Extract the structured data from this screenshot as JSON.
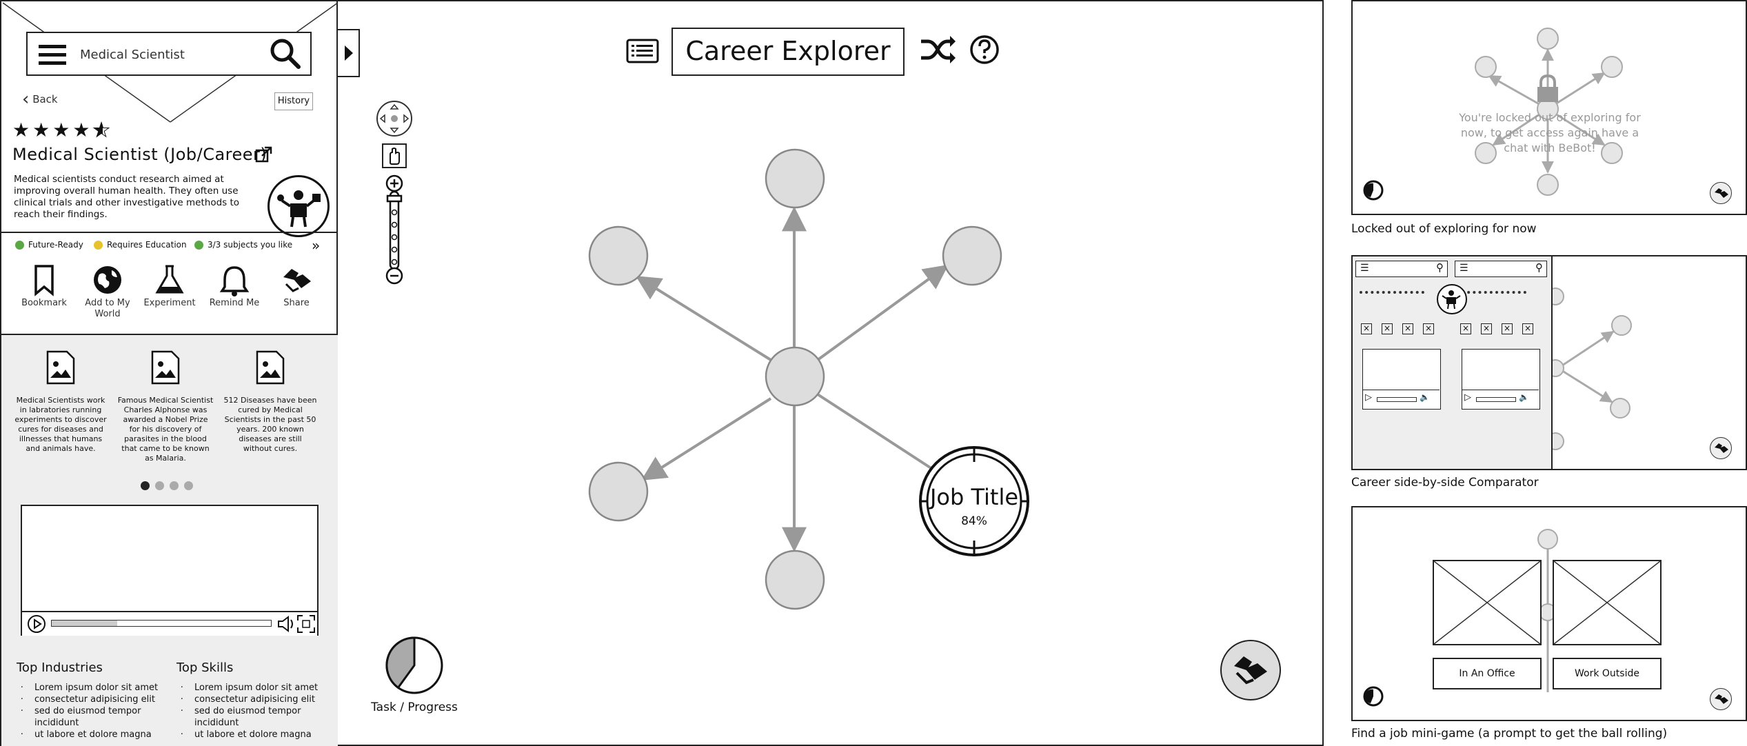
{
  "search": {
    "value": "Medical Scientist"
  },
  "nav": {
    "back": "Back",
    "history": "History"
  },
  "career": {
    "title": "Medical Scientist (Job/Career)",
    "rating": 4.5,
    "description": "Medical scientists conduct research aimed at improving overall human health. They often use clinical trials and other investigative methods to reach their findings."
  },
  "tags": [
    {
      "label": "Future-Ready",
      "color": "#5aa844"
    },
    {
      "label": "Requires Education",
      "color": "#e8c22a"
    },
    {
      "label": "3/3 subjects you like",
      "color": "#5aa844"
    }
  ],
  "actions": [
    {
      "label": "Bookmark",
      "icon": "bookmark-icon"
    },
    {
      "label": "Add to My World",
      "icon": "globe-icon"
    },
    {
      "label": "Experiment",
      "icon": "flask-icon"
    },
    {
      "label": "Remind Me",
      "icon": "bell-icon"
    },
    {
      "label": "Share",
      "icon": "share-icon"
    }
  ],
  "facts": [
    "Medical Scientists work in labratories running experiments to discover cures for diseases and illnesses that humans and animals have.",
    "Famous Medical Scientist Charles Alphonse was awarded a Nobel Prize for his discovery of parasites in the blood that came to be known as Malaria.",
    "512 Diseases have been cured by Medical Scientists in the past 50 years. 200 known diseases are still without cures."
  ],
  "carousel": {
    "pages": 4,
    "active": 0
  },
  "industries": {
    "title": "Top Industries",
    "items": [
      "Lorem ipsum dolor sit amet",
      "consectetur adipisicing elit",
      "sed do eiusmod tempor incididunt",
      "ut labore et dolore magna"
    ]
  },
  "skills": {
    "title": "Top Skills",
    "items": [
      "Lorem ipsum dolor sit amet",
      "consectetur adipisicing elit",
      "sed do eiusmod tempor incididunt",
      "ut labore et dolore magna"
    ]
  },
  "main": {
    "title": "Career Explorer",
    "job_title": "Job Title",
    "job_percent": "84%",
    "task_label": "Task / Progress",
    "task_progress": 0.4
  },
  "panels": {
    "locked": {
      "message": "You're locked out of exploring for now, to get access again have a chat with BeBot!",
      "caption": "Locked out of exploring for now"
    },
    "comparator": {
      "caption": "Career side-by-side Comparator"
    },
    "minigame": {
      "caption": "Find a job mini-game (a prompt to get the ball rolling)",
      "option_a": "In An Office",
      "option_b": "Work Outside"
    }
  }
}
